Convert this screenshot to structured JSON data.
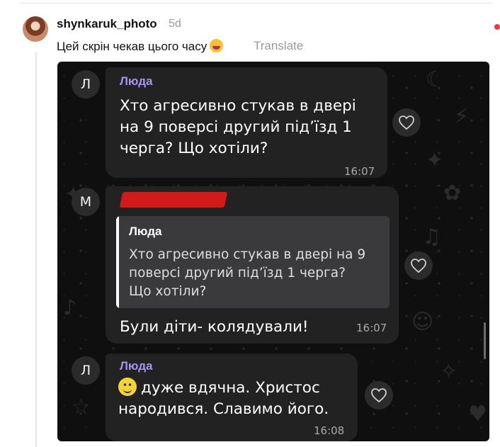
{
  "post": {
    "username": "shynkaruk_photo",
    "time_ago": "5d",
    "text": "Цей скрін чекав цього часу",
    "emoji": "laughing-face-emoji",
    "translate_label": "Translate"
  },
  "screenshot": {
    "messages": [
      {
        "avatar_letter": "Л",
        "sender": "Люда",
        "lines": [
          "Хто агресивно стукав в двері",
          "на 9 поверсі другий під’їзд 1",
          "черга?  Що хотіли?"
        ],
        "time": "16:07",
        "reaction_icon": "heart-outline-icon"
      },
      {
        "avatar_letter": "М",
        "sender_redacted": true,
        "reply": {
          "author": "Люда",
          "lines": [
            "Хто агресивно стукав в двері на 9",
            "поверсі другий під’їзд 1 черга?",
            "Що хотіли?"
          ]
        },
        "text": "Були діти- колядували!",
        "time": "16:07",
        "reaction_icon": "heart-outline-icon"
      },
      {
        "avatar_letter": "Л",
        "sender": "Люда",
        "emoji": "smiling-face-emoji",
        "lines": [
          "дуже вдячна. Христос",
          "народився. Славимо його."
        ],
        "time": "16:08",
        "reaction_icon": "heart-outline-icon"
      }
    ]
  },
  "colors": {
    "sender_name": "#a893ef",
    "bubble": "#222222",
    "chat_background": "#0f0f0f",
    "redaction": "#d21a1a",
    "notification_dot": "#ff3040"
  }
}
